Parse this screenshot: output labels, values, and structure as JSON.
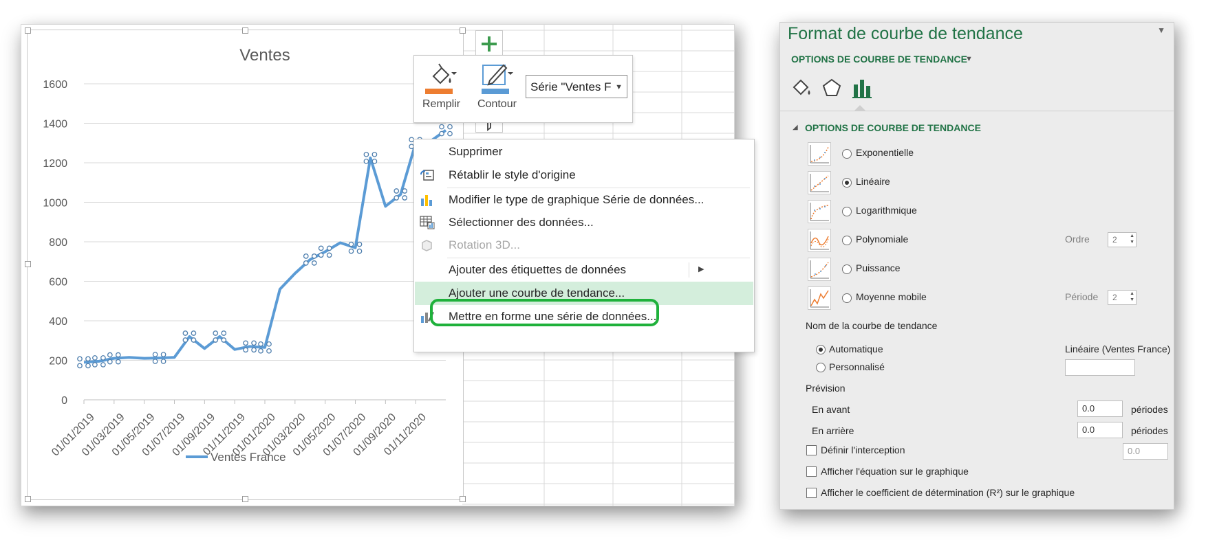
{
  "chart_data": {
    "type": "line",
    "title": "Ventes",
    "legend": [
      "Ventes France"
    ],
    "legend_position": "bottom",
    "grid": true,
    "ylim": [
      0,
      1600
    ],
    "yticks": [
      0,
      200,
      400,
      600,
      800,
      1000,
      1200,
      1400,
      1600
    ],
    "xticks": [
      "01/01/2019",
      "01/03/2019",
      "01/05/2019",
      "01/07/2019",
      "01/09/2019",
      "01/11/2019",
      "01/01/2020",
      "01/03/2020",
      "01/05/2020",
      "01/07/2020",
      "01/09/2020",
      "01/11/2020"
    ],
    "series": [
      {
        "name": "Ventes France",
        "color": "#5b9bd5",
        "points": [
          [
            0,
            190
          ],
          [
            0.5,
            195
          ],
          [
            1,
            210
          ],
          [
            1.5,
            215
          ],
          [
            2,
            210
          ],
          [
            2.5,
            212
          ],
          [
            3,
            215
          ],
          [
            3.5,
            320
          ],
          [
            4,
            260
          ],
          [
            4.5,
            320
          ],
          [
            5,
            255
          ],
          [
            5.5,
            270
          ],
          [
            6,
            265
          ],
          [
            6.5,
            560
          ],
          [
            7,
            640
          ],
          [
            7.5,
            710
          ],
          [
            8,
            750
          ],
          [
            8.5,
            795
          ],
          [
            9,
            770
          ],
          [
            9.5,
            1225
          ],
          [
            10,
            980
          ],
          [
            10.5,
            1040
          ],
          [
            11,
            1300
          ],
          [
            11.5,
            1310
          ],
          [
            12,
            1365
          ]
        ]
      }
    ]
  },
  "toolbar": {
    "fill_label": "Remplir",
    "outline_label": "Contour",
    "series_select": "Série \"Ventes F",
    "fill_color": "#ed7d31",
    "outline_color": "#5b9bd5"
  },
  "context_menu": {
    "items": [
      {
        "label": "Supprimer",
        "disabled": false
      },
      {
        "label": "Rétablir le style d'origine",
        "disabled": false
      },
      {
        "label": "Modifier le type de graphique Série de données...",
        "disabled": false
      },
      {
        "label": "Sélectionner des données...",
        "disabled": false
      },
      {
        "label": "Rotation 3D...",
        "disabled": true
      },
      {
        "label": "Ajouter des étiquettes de données",
        "disabled": false,
        "submenu": true
      },
      {
        "label": "Ajouter une courbe de tendance...",
        "disabled": false,
        "highlighted": true
      },
      {
        "label": "Mettre en forme une série de données...",
        "disabled": false
      }
    ]
  },
  "pane": {
    "title": "Format de courbe de tendance",
    "subtitle": "OPTIONS DE COURBE DE TENDANCE",
    "section": "OPTIONS DE COURBE DE TENDANCE",
    "accent": "#217346",
    "types": [
      {
        "label": "Exponentielle",
        "selected": false
      },
      {
        "label": "Linéaire",
        "selected": true
      },
      {
        "label": "Logarithmique",
        "selected": false
      },
      {
        "label": "Polynomiale",
        "selected": false,
        "param_label": "Ordre",
        "param_value": "2"
      },
      {
        "label": "Puissance",
        "selected": false
      },
      {
        "label": "Moyenne mobile",
        "selected": false,
        "param_label": "Période",
        "param_value": "2"
      }
    ],
    "name_label": "Nom de la courbe de tendance",
    "auto_label": "Automatique",
    "auto_value": "Linéaire (Ventes France)",
    "custom_label": "Personnalisé",
    "custom_value": "",
    "forecast_label": "Prévision",
    "forward_label": "En avant",
    "forward_value": "0.0",
    "backward_label": "En arrière",
    "backward_value": "0.0",
    "periods_label": "périodes",
    "intercept_label": "Définir l'interception",
    "intercept_value": "0.0",
    "equation_label": "Afficher l'équation sur le graphique",
    "r2_label": "Afficher le coefficient de détermination (R²) sur le graphique"
  }
}
